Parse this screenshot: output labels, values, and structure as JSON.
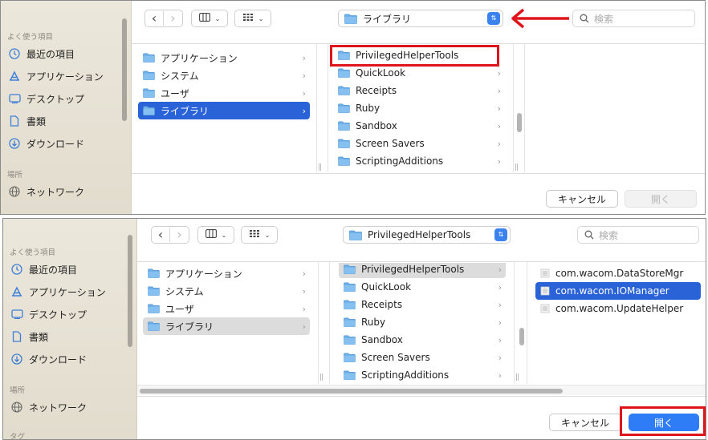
{
  "sidebar": {
    "favorites_title": "よく使う項目",
    "items": [
      {
        "label": "最近の項目",
        "icon": "clock-icon"
      },
      {
        "label": "アプリケーション",
        "icon": "apps-icon"
      },
      {
        "label": "デスクトップ",
        "icon": "desktop-icon"
      },
      {
        "label": "書類",
        "icon": "document-icon"
      },
      {
        "label": "ダウンロード",
        "icon": "download-icon"
      }
    ],
    "locations_title": "場所",
    "network_label": "ネットワーク",
    "tags_title": "タグ"
  },
  "toolbar": {
    "back": "‹",
    "forward": "›",
    "search_placeholder": "検索"
  },
  "panel1": {
    "path_label": "ライブラリ",
    "col1": [
      {
        "label": "アプリケーション"
      },
      {
        "label": "システム"
      },
      {
        "label": "ユーザ"
      },
      {
        "label": "ライブラリ"
      }
    ],
    "col2": [
      {
        "label": "PrivilegedHelperTools"
      },
      {
        "label": "QuickLook"
      },
      {
        "label": "Receipts"
      },
      {
        "label": "Ruby"
      },
      {
        "label": "Sandbox"
      },
      {
        "label": "Screen Savers"
      },
      {
        "label": "ScriptingAdditions"
      }
    ],
    "cancel_label": "キャンセル",
    "open_label": "開く"
  },
  "panel2": {
    "path_label": "PrivilegedHelperTools",
    "col1": [
      {
        "label": "アプリケーション"
      },
      {
        "label": "システム"
      },
      {
        "label": "ユーザ"
      },
      {
        "label": "ライブラリ"
      }
    ],
    "col2": [
      {
        "label": "PrivilegedHelperTools"
      },
      {
        "label": "QuickLook"
      },
      {
        "label": "Receipts"
      },
      {
        "label": "Ruby"
      },
      {
        "label": "Sandbox"
      },
      {
        "label": "Screen Savers"
      },
      {
        "label": "ScriptingAdditions"
      }
    ],
    "col3": [
      {
        "label": "com.wacom.DataStoreMgr"
      },
      {
        "label": "com.wacom.IOManager"
      },
      {
        "label": "com.wacom.UpdateHelper"
      }
    ],
    "cancel_label": "キャンセル",
    "open_label": "開く"
  },
  "colors": {
    "accent": "#2a62d8",
    "annotation": "#e0141b",
    "folder": "#6fb0e8"
  }
}
